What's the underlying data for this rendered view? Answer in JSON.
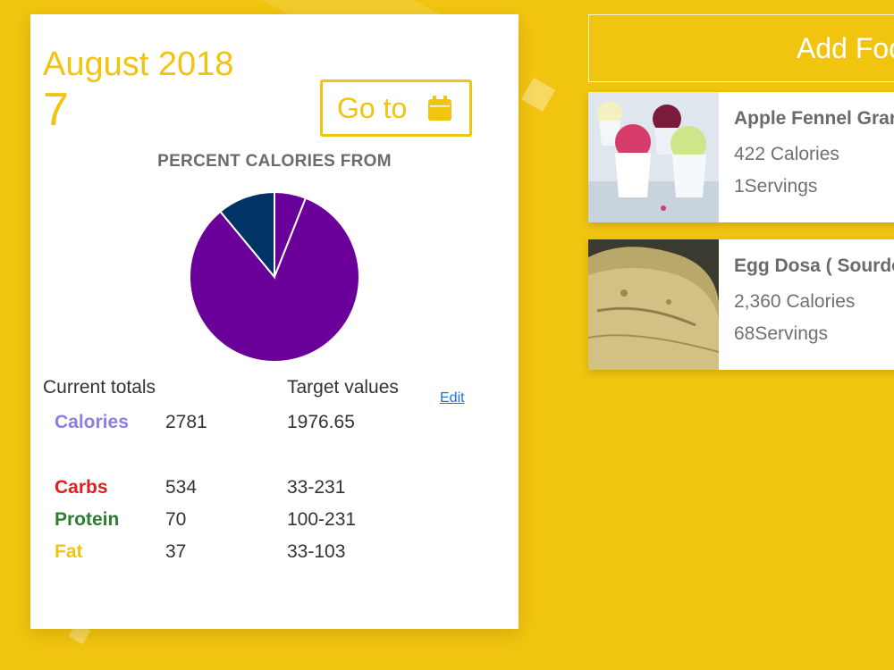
{
  "calendar": {
    "month_year": "August 2018",
    "day": "7",
    "goto_label": "Go to",
    "goto_icon": "calendar-icon"
  },
  "chart_data": {
    "type": "pie",
    "title": "PERCENT CALORIES FROM",
    "slices": [
      {
        "label": "Carbs",
        "value": 83,
        "color": "#6a0099"
      },
      {
        "label": "Protein",
        "value": 11,
        "color": "#003366"
      },
      {
        "label": "Fat",
        "value": 6,
        "color": "#6a0099"
      }
    ]
  },
  "totals": {
    "current_header": "Current totals",
    "target_header": "Target values",
    "edit_label": "Edit",
    "rows": [
      {
        "name": "Calories",
        "current": "2781",
        "target": "1976.65",
        "color": "#8c7fe0"
      },
      {
        "name": "Carbs",
        "current": "534",
        "target": "33-231",
        "color": "#e02020"
      },
      {
        "name": "Protein",
        "current": "70",
        "target": "100-231",
        "color": "#2e7d32"
      },
      {
        "name": "Fat",
        "current": "37",
        "target": "33-103",
        "color": "#f1c40f"
      }
    ]
  },
  "add_food": {
    "label": "Add Food"
  },
  "foods": [
    {
      "name": "Apple Fennel Granita",
      "calories": "422 Calories",
      "servings": "1Servings"
    },
    {
      "name": "Egg Dosa ( Sourdough",
      "calories": "2,360 Calories",
      "servings": "68Servings"
    }
  ]
}
